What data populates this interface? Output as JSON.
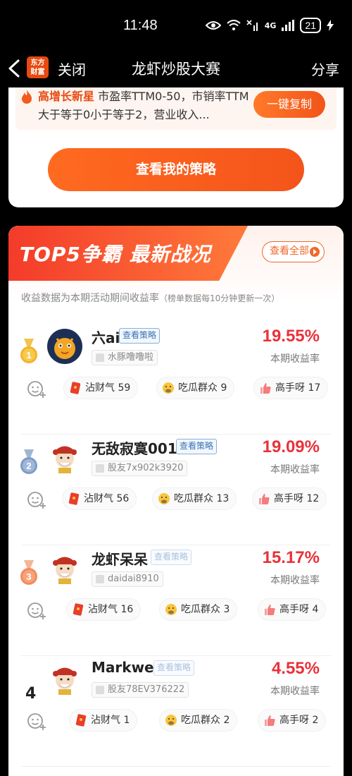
{
  "status_bar": {
    "time": "11:48",
    "battery": "21",
    "net": "4G"
  },
  "nav": {
    "close": "关闭",
    "title": "龙虾炒股大赛",
    "share": "分享",
    "logo_line1": "东方",
    "logo_line2": "财富"
  },
  "strategy": {
    "tag": "高增长新星",
    "text": " 市盈率TTM0-50，市销率TTM大于等于0小于等于2，营业收入...",
    "copy_label": "一键复制",
    "view_mine_label": "查看我的策略"
  },
  "ranking": {
    "title": "TOP5争霸 最新战况",
    "view_all": "查看全部",
    "subtitle": "收益数据为本期活动期间收益率",
    "subtitle_note": "（榜单数据每10分钟更新一次）",
    "tag_label": "查看策略",
    "return_label": "本期收益率",
    "rows": [
      {
        "rank": "1",
        "name": "六ai",
        "user_id": "水豚噜噜啦",
        "return": "19.55%",
        "r1": "沾财气 59",
        "r2": "吃瓜群众 9",
        "r3": "高手呀 17"
      },
      {
        "rank": "2",
        "name": "无敌寂寞001",
        "user_id": "股友7x902k3920",
        "return": "19.09%",
        "r1": "沾财气 56",
        "r2": "吃瓜群众 13",
        "r3": "高手呀 12"
      },
      {
        "rank": "3",
        "name": "龙虾呆呆",
        "user_id": "daidai8910",
        "return": "15.17%",
        "r1": "沾财气 16",
        "r2": "吃瓜群众 3",
        "r3": "高手呀 4"
      },
      {
        "rank": "4",
        "name": "Markwer",
        "user_id": "股友78EV376222",
        "return": "4.55%",
        "r1": "沾财气 1",
        "r2": "吃瓜群众 2",
        "r3": "高手呀 2"
      }
    ]
  },
  "colors": {
    "accent": "#f4541a",
    "return_red": "#e8323a"
  }
}
